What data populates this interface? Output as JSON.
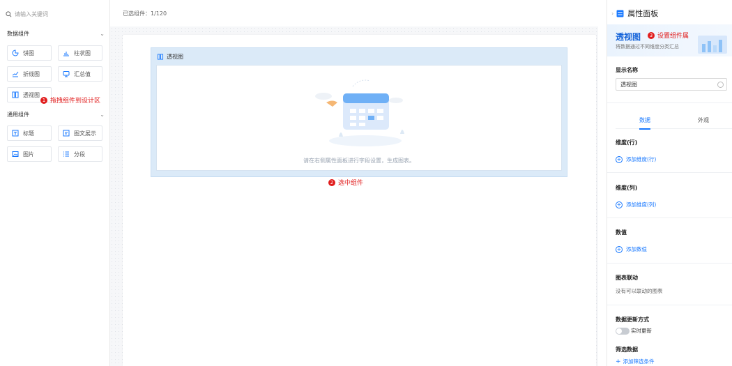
{
  "left": {
    "search_placeholder": "请输入关键词",
    "data_section": "数据组件",
    "general_section": "通用组件",
    "components": [
      {
        "label": "饼图",
        "icon": "pie-chart-icon"
      },
      {
        "label": "柱状图",
        "icon": "bar-chart-icon"
      },
      {
        "label": "折线图",
        "icon": "line-chart-icon"
      },
      {
        "label": "汇总值",
        "icon": "summary-icon"
      },
      {
        "label": "透视图",
        "icon": "pivot-table-icon"
      }
    ],
    "general_components": [
      {
        "label": "标题",
        "icon": "title-icon"
      },
      {
        "label": "图文展示",
        "icon": "image-text-icon"
      },
      {
        "label": "图片",
        "icon": "image-icon"
      },
      {
        "label": "分段",
        "icon": "segment-icon"
      }
    ],
    "annotation_1": {
      "num": "1",
      "text": "拖拽组件到设计区"
    }
  },
  "topbar": {
    "selected": "已选组件：1/120"
  },
  "canvas": {
    "pivot_title": "透视图",
    "empty_text": "请在右侧属性面板进行字段设置，生成图表。",
    "annotation_2": {
      "num": "2",
      "text": "选中组件"
    }
  },
  "right": {
    "panel_title": "属性面板",
    "hero_title": "透视图",
    "hero_desc": "将数据通过不同维度分类汇总",
    "annotation_3": {
      "num": "3",
      "text": "设置组件属"
    },
    "display_name_label": "显示名称",
    "display_name_value": "透视图",
    "tabs": [
      "数据",
      "外观"
    ],
    "dim_row_label": "维度(行)",
    "dim_row_add": "添加维度(行)",
    "dim_col_label": "维度(列)",
    "dim_col_add": "添加维度(列)",
    "value_label": "数值",
    "value_add": "添加数值",
    "link_label": "图表联动",
    "link_desc": "没有可以联动的图表",
    "update_label": "数据更新方式",
    "update_toggle": "实时更新",
    "filter_label": "筛选数据",
    "filter_add": "添加筛选条件"
  },
  "colors": {
    "accent": "#1677ff",
    "annotation": "#e11d1d"
  }
}
